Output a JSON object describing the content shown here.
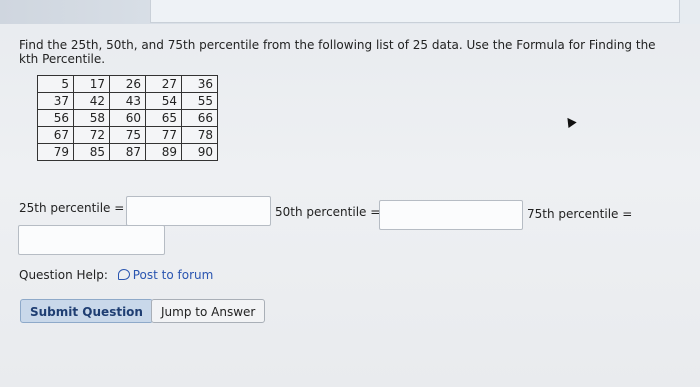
{
  "question": "Find the 25th, 50th, and 75th percentile from the following list of 25 data. Use the Formula for Finding the kth Percentile.",
  "table": {
    "rows": [
      [
        "5",
        "17",
        "26",
        "27",
        "36"
      ],
      [
        "37",
        "42",
        "43",
        "54",
        "55"
      ],
      [
        "56",
        "58",
        "60",
        "65",
        "66"
      ],
      [
        "67",
        "72",
        "75",
        "77",
        "78"
      ],
      [
        "79",
        "85",
        "87",
        "89",
        "90"
      ]
    ]
  },
  "answers": {
    "p25_label": "25th percentile =",
    "p50_label": "50th percentile =",
    "p75_label": "75th percentile =",
    "p25_value": "",
    "p50_value": "",
    "p75_value": ""
  },
  "help": {
    "label": "Question Help:",
    "link": "Post to forum",
    "icon": "chat-bubble-icon"
  },
  "buttons": {
    "submit": "Submit Question",
    "jump": "Jump to Answer"
  },
  "colors": {
    "link": "#2a55b0",
    "submit_bg": "#c9d8ea",
    "submit_text": "#1f3e72"
  }
}
